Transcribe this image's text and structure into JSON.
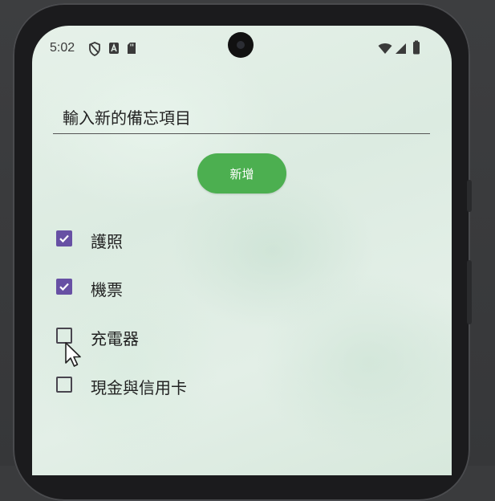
{
  "status_bar": {
    "time": "5:02",
    "left_icons": [
      "shield-icon",
      "a-icon",
      "sd-card-icon"
    ],
    "right_icons": [
      "wifi-icon",
      "signal-icon",
      "battery-icon"
    ]
  },
  "memo_input": {
    "placeholder": "輸入新的備忘項目",
    "value": ""
  },
  "add_button": {
    "label": "新增",
    "color": "#4caf50"
  },
  "checkbox_color": "#6750a4",
  "items": [
    {
      "label": "護照",
      "checked": true
    },
    {
      "label": "機票",
      "checked": true
    },
    {
      "label": "充電器",
      "checked": false
    },
    {
      "label": "現金與信用卡",
      "checked": false
    }
  ]
}
